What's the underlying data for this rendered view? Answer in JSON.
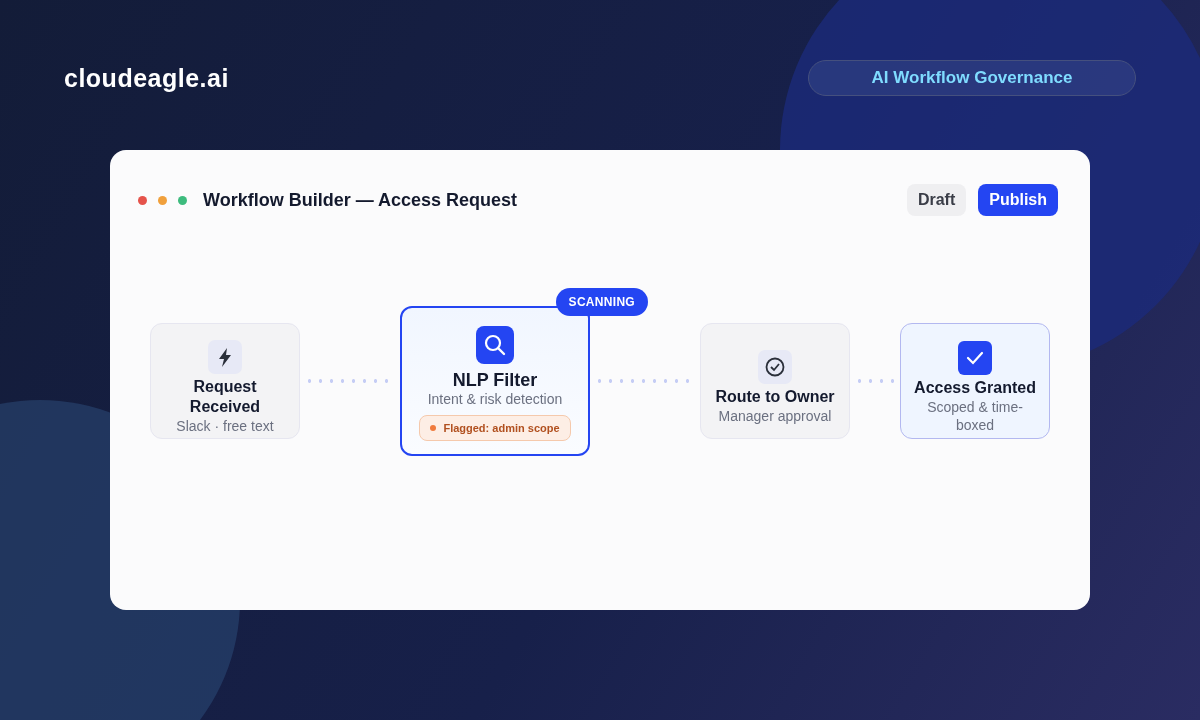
{
  "brand": {
    "name": "cloudeagle.ai"
  },
  "tag": {
    "label": "AI Workflow Governance"
  },
  "window": {
    "title": "Workflow Builder — Access Request",
    "dots": [
      {
        "color": "#e5534b"
      },
      {
        "color": "#f0a03c"
      },
      {
        "color": "#3dbb7d"
      }
    ],
    "buttons": [
      {
        "label": "Draft",
        "kind": "secondary"
      },
      {
        "label": "Publish",
        "kind": "primary"
      }
    ]
  },
  "nodes": [
    {
      "kind": "trigger",
      "active": false,
      "done": false,
      "title": "Request Received",
      "subtitle": "Slack · free text"
    },
    {
      "kind": "filter",
      "active": true,
      "done": false,
      "badge": "SCANNING",
      "title": "NLP Filter",
      "subtitle": "Intent & risk detection",
      "flag": "Flagged: admin scope"
    },
    {
      "kind": "approval",
      "active": false,
      "done": false,
      "title": "Route to Owner",
      "subtitle": "Manager approval"
    },
    {
      "kind": "grant",
      "active": false,
      "done": true,
      "title": "Access Granted",
      "subtitle": "Scoped & time-boxed"
    }
  ]
}
